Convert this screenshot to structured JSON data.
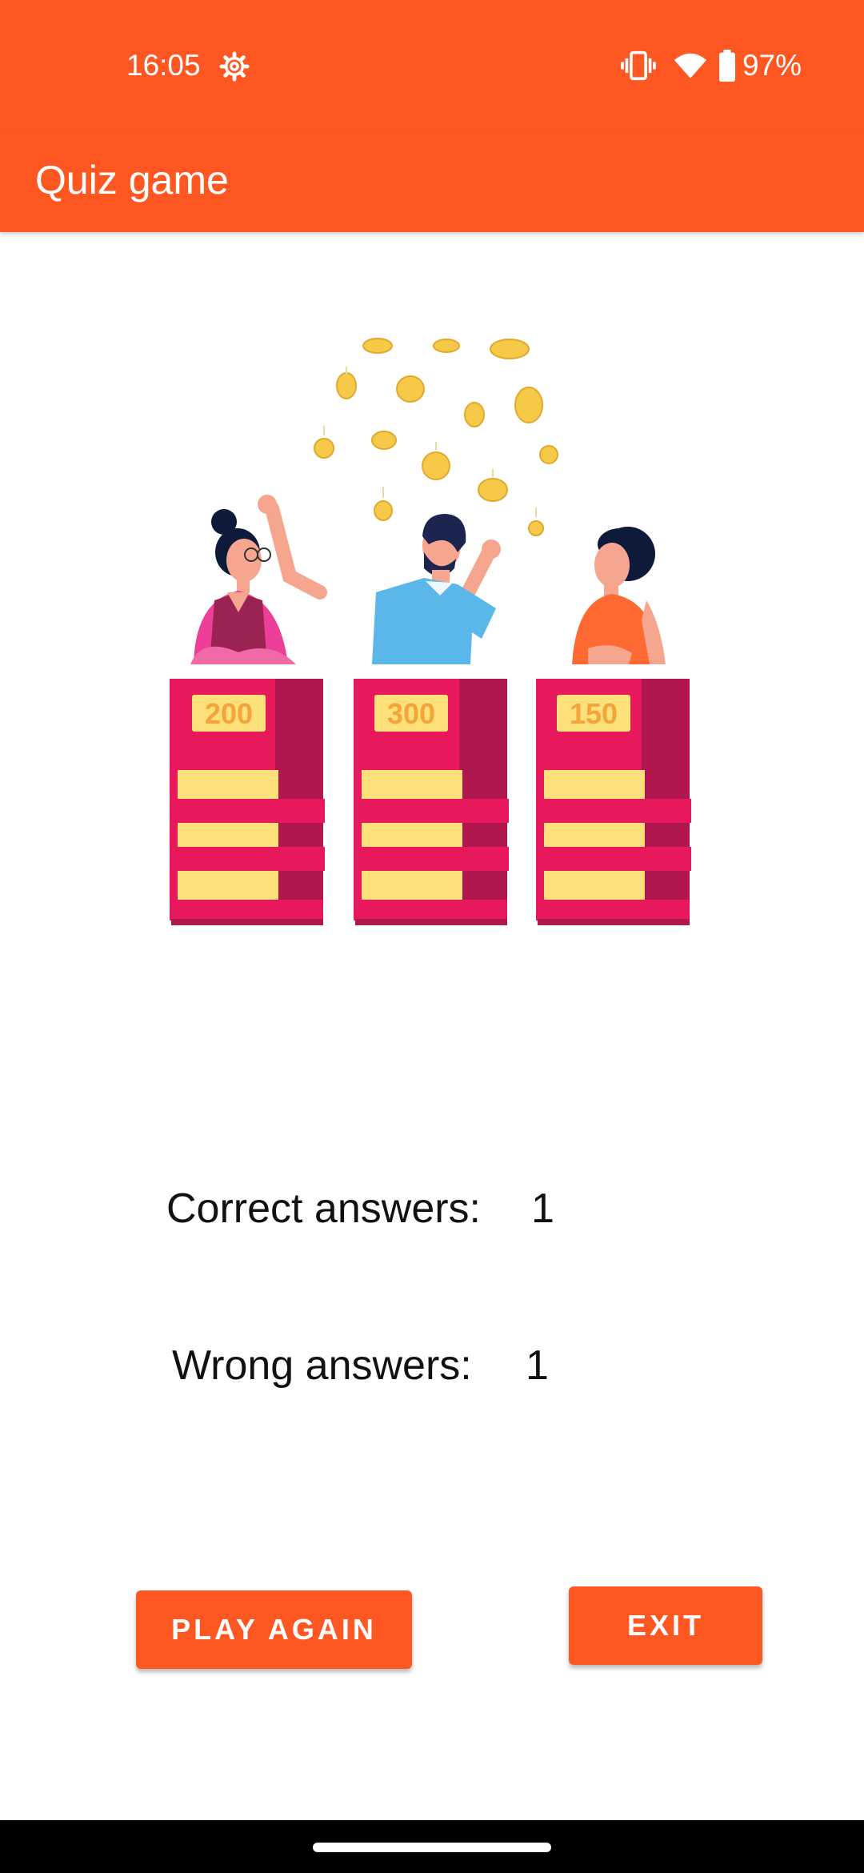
{
  "status_bar": {
    "time": "16:05",
    "battery_percent": "97%",
    "icons": [
      "settings-gear-icon",
      "vibrate-icon",
      "wifi-icon",
      "battery-icon"
    ]
  },
  "app_bar": {
    "title": "Quiz game"
  },
  "illustration": {
    "podium_scores": [
      "200",
      "300",
      "150"
    ]
  },
  "results": {
    "correct_label": "Correct answers:",
    "correct_value": "1",
    "wrong_label": "Wrong answers:",
    "wrong_value": "1"
  },
  "buttons": {
    "play_again": "PLAY AGAIN",
    "exit": "EXIT"
  },
  "colors": {
    "primary": "#ff5722",
    "podium_pink": "#e8185c",
    "podium_dark": "#b0174f",
    "podium_yellow": "#fde07a",
    "coin": "#f7c948"
  }
}
